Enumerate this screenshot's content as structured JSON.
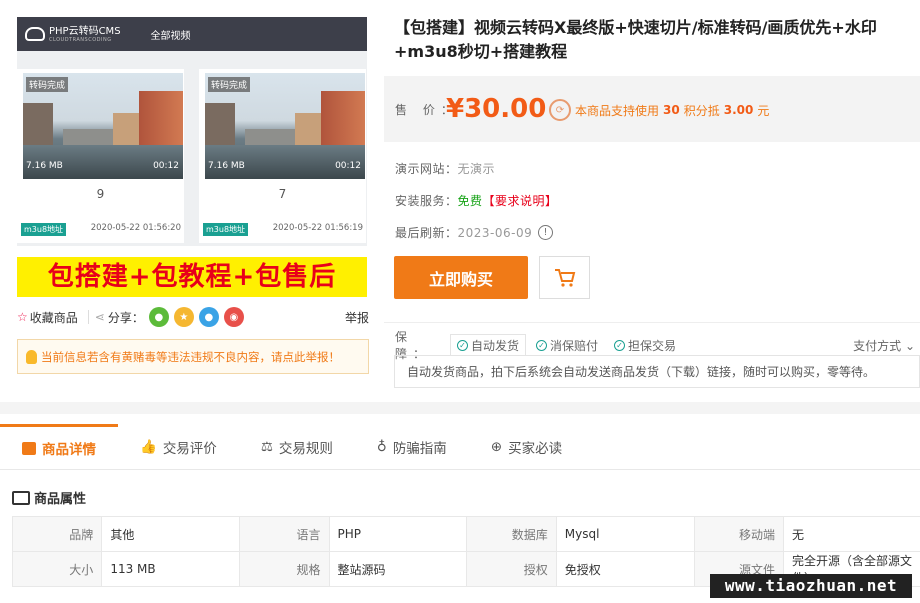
{
  "gallery": {
    "logo_text": "PHP云转码CMS",
    "logo_sub": "CLOUDTRANSCODING",
    "nav": "全部视频",
    "cards": [
      {
        "tag": "转码完成",
        "size": "7.16 MB",
        "duration": "00:12",
        "number": "9",
        "badge": "m3u8地址",
        "date": "2020-05-22 01:56:20"
      },
      {
        "tag": "转码完成",
        "size": "7.16 MB",
        "duration": "00:12",
        "number": "7",
        "badge": "m3u8地址",
        "date": "2020-05-22 01:56:19"
      }
    ],
    "banner": "包搭建+包教程+包售后"
  },
  "actions": {
    "favorite": "收藏商品",
    "share": "分享：",
    "report": "举报"
  },
  "notice": "当前信息若含有黄赌毒等违法违规不良内容，请点此举报！",
  "product": {
    "title": "【包搭建】视频云转码X最终版+快速切片/标准转码/画质优先+水印+m3u8秒切+搭建教程",
    "price_label": "售 价：",
    "price": "¥30.00",
    "points_text_a": "本商品支持使用",
    "points_value": "30",
    "points_text_b": "积分抵",
    "points_money": "3.00",
    "points_text_c": "元",
    "demo_label": "演示网站：",
    "demo_value": "无演示",
    "install_label": "安装服务：",
    "install_value": "免费",
    "install_note": "【要求说明】",
    "refresh_label": "最后刷新：",
    "refresh_value": "2023-06-09",
    "buy_label": "立即购买"
  },
  "guarantee": {
    "label": "保 障：",
    "items": [
      "自动发货",
      "消保赔付",
      "担保交易"
    ],
    "pay_method": "支付方式",
    "desc": "自动发货商品，拍下后系统会自动发送商品发货（下载）链接，随时可以购买，零等待。"
  },
  "tabs": [
    "商品详情",
    "交易评价",
    "交易规则",
    "防骗指南",
    "买家必读"
  ],
  "attributes": {
    "title": "商品属性",
    "rows": [
      [
        [
          "品牌",
          "其他"
        ],
        [
          "语言",
          "PHP"
        ],
        [
          "数据库",
          "Mysql"
        ],
        [
          "移动端",
          "无"
        ]
      ],
      [
        [
          "大小",
          "113 MB"
        ],
        [
          "规格",
          "整站源码"
        ],
        [
          "授权",
          "免授权"
        ],
        [
          "源文件",
          "完全开源（含全部源文件）"
        ]
      ]
    ]
  },
  "watermark": "www.tiaozhuan.net",
  "colors": {
    "accent": "#f07a17",
    "price": "#f25b16",
    "banner_bg": "#fff000",
    "banner_text": "#e8001a",
    "teal": "#1aa092"
  }
}
